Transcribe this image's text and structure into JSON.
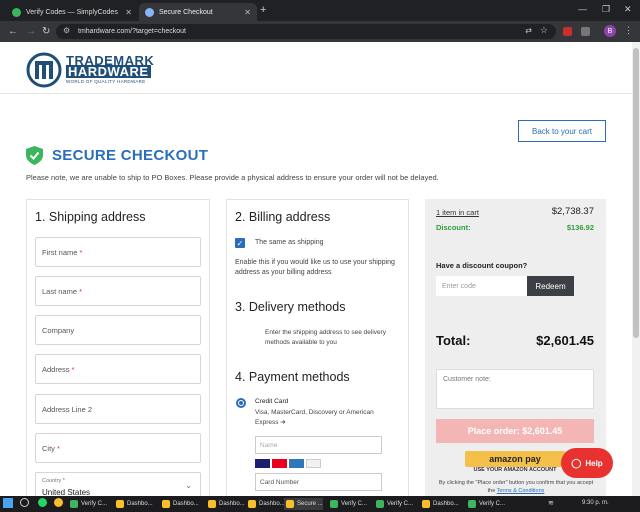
{
  "browser": {
    "tabs": [
      {
        "title": "Verify Codes — SimplyCodes"
      },
      {
        "title": "Secure Checkout"
      }
    ],
    "url": "tmhardware.com/?target=checkout",
    "profile_initial": "B"
  },
  "brand": {
    "line1": "TRADEMARK",
    "line2": "HARDWARE",
    "tagline": "WORLD OF QUALITY HARDWARE",
    "accent": "#2a6ebb"
  },
  "header": {
    "back_to_cart": "Back to your cart",
    "title": "SECURE CHECKOUT",
    "notice": "Please note, we are unable to ship to PO Boxes. Please provide a physical address to ensure your order will not be delayed."
  },
  "shipping": {
    "heading": "1.  Shipping address",
    "fields": {
      "first_name": "First name",
      "last_name": "Last name",
      "company": "Company",
      "address": "Address",
      "address2": "Address Line 2",
      "city": "City",
      "country_label": "Country",
      "country_value": "United States"
    },
    "required_mark": "*"
  },
  "billing": {
    "heading": "2.  Billing address",
    "same_as_shipping": "The same as shipping",
    "note": "Enable this if you would like us to use your shipping address as your billing address"
  },
  "delivery": {
    "heading": "3.  Delivery methods",
    "note": "Enter the shipping address to see delivery methods available to you"
  },
  "payment": {
    "heading": "4.  Payment methods",
    "option_title": "Credit Card",
    "option_desc": "Visa, MasterCard, Discovery or American Express ➔",
    "name_placeholder": "Name",
    "card_placeholder": "Card Number"
  },
  "summary": {
    "items_link": "1 item in cart",
    "items_total": "$2,738.37",
    "discount_label": "Discount:",
    "discount_value": "$136.92",
    "coupon_prompt": "Have a discount coupon?",
    "coupon_placeholder": "Enter code",
    "redeem": "Redeem",
    "total_label": "Total:",
    "total_value": "$2,601.45",
    "customer_note_placeholder": "Customer note:",
    "place_order": "Place order: $2,601.45",
    "amazon_pay": "amazon pay",
    "amazon_caption": "USE YOUR AMAZON ACCOUNT",
    "disclaimer_prefix": "By clicking the \"Place order\" button you confirm that you accept the",
    "terms_link": "Terms & Conditions",
    "discount_color": "#2e9e3a"
  },
  "help_button": "Help",
  "taskbar": {
    "items": [
      "Verify C...",
      "Dashbo...",
      "Dashbo...",
      "Dashbo...",
      "Dashbo...",
      "Secure ...",
      "Verify C...",
      "Verify C...",
      "Dashbo...",
      "Verify C..."
    ],
    "time": "9:30 p. m."
  }
}
